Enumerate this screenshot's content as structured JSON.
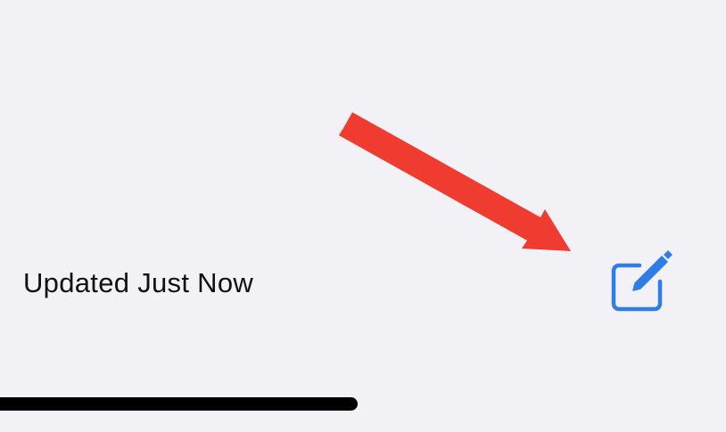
{
  "toolbar": {
    "status_text": "Updated Just Now",
    "compose_icon": "compose-icon",
    "accent_color": "#2f7ee8"
  },
  "annotation": {
    "arrow_icon": "arrow-icon",
    "arrow_color": "#f03b30"
  },
  "home_indicator": {
    "color": "#000000"
  }
}
